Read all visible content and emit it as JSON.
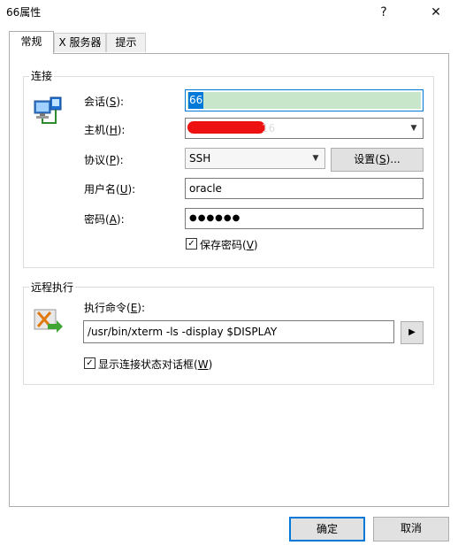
{
  "window": {
    "title": "66属性",
    "help_glyph": "?",
    "close_glyph": "✕"
  },
  "tabs": [
    {
      "label": "常规"
    },
    {
      "label": "X 服务器"
    },
    {
      "label": "提示"
    }
  ],
  "connection": {
    "group_label": "连接",
    "session_label_prefix": "会话(",
    "session_label_key": "S",
    "session_label_suffix": "):",
    "session_value": "66",
    "host_label_prefix": "主机(",
    "host_label_key": "H",
    "host_label_suffix": "):",
    "host_value_visible": "16",
    "protocol_label_prefix": "协议(",
    "protocol_label_key": "P",
    "protocol_label_suffix": "):",
    "protocol_value": "SSH",
    "settings_prefix": "设置(",
    "settings_key": "S",
    "settings_suffix": ")...",
    "user_label_prefix": "用户名(",
    "user_label_key": "U",
    "user_label_suffix": "):",
    "user_value": "oracle",
    "password_label_prefix": "密码(",
    "password_label_key": "A",
    "password_label_suffix": "):",
    "password_value": "●●●●●●",
    "save_password_prefix": "保存密码(",
    "save_password_key": "V",
    "save_password_suffix": ")",
    "save_password_checked": true
  },
  "remote": {
    "group_label": "远程执行",
    "command_label_prefix": "执行命令(",
    "command_label_key": "E",
    "command_label_suffix": "):",
    "command_value": "/usr/bin/xterm -ls -display $DISPLAY",
    "show_status_prefix": "显示连接状态对话框(",
    "show_status_key": "W",
    "show_status_suffix": ")",
    "show_status_checked": true
  },
  "footer": {
    "ok_label": "确定",
    "cancel_label": "取消"
  },
  "colors": {
    "accent": "#0078d7",
    "selection": "#c8e6c9",
    "redaction": "#ee1111"
  }
}
